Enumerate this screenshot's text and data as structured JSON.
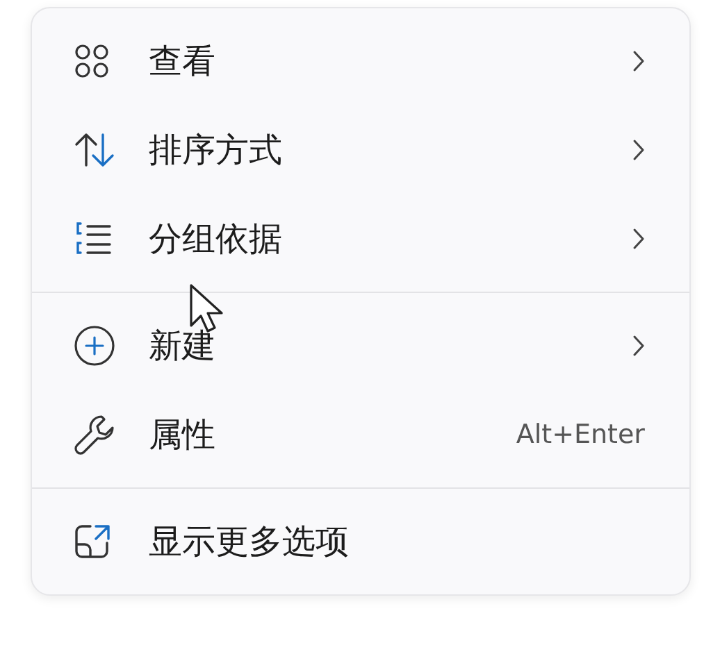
{
  "menu": {
    "groups": [
      {
        "items": [
          {
            "label": "查看",
            "submenu": true
          },
          {
            "label": "排序方式",
            "submenu": true
          },
          {
            "label": "分组依据",
            "submenu": true
          }
        ]
      },
      {
        "items": [
          {
            "label": "新建",
            "submenu": true
          },
          {
            "label": "属性",
            "submenu": false,
            "shortcut": "Alt+Enter"
          }
        ]
      },
      {
        "items": [
          {
            "label": "显示更多选项",
            "submenu": false
          }
        ]
      }
    ]
  }
}
